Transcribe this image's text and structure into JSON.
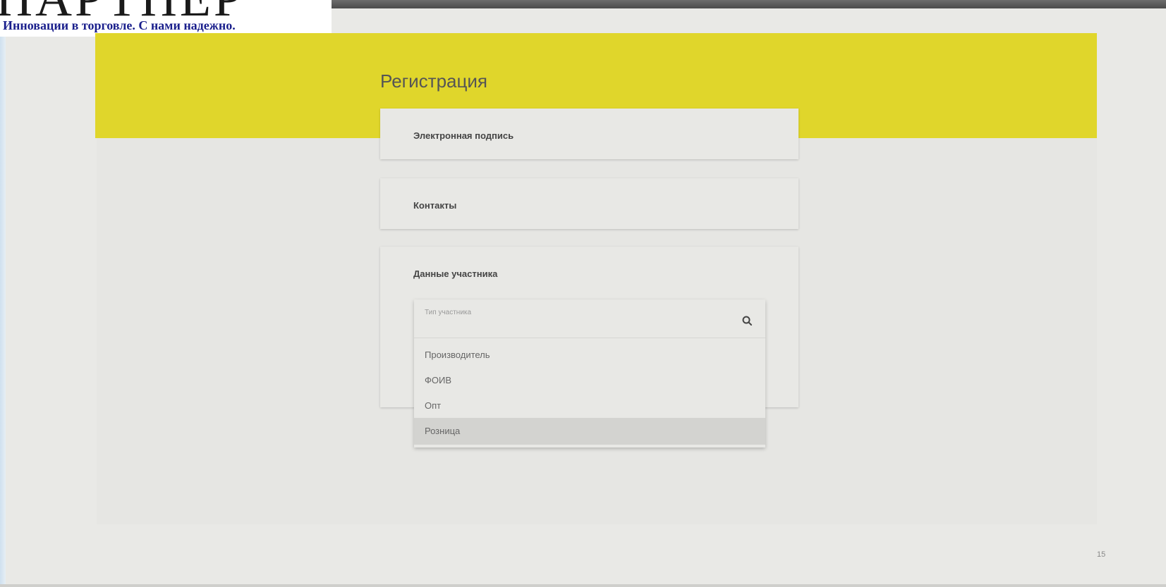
{
  "logo": {
    "letters": "ПАРТНЕР",
    "tagline": "Инновации в торговле. С нами надежно."
  },
  "page": {
    "title": "Регистрация",
    "number": "15"
  },
  "sections": {
    "signature": "Электронная подпись",
    "contacts": "Контакты",
    "participant": "Данные участника"
  },
  "participant_type": {
    "label": "Тип участника",
    "value": "",
    "options": [
      "Производитель",
      "ФОИВ",
      "Опт",
      "Розница"
    ],
    "highlighted": "Розница"
  },
  "colors": {
    "header_yellow": "#e0d62b",
    "tagline_blue": "#1a1f8c",
    "background": "#e9e9e6"
  },
  "icons": {
    "search": "search-icon"
  }
}
